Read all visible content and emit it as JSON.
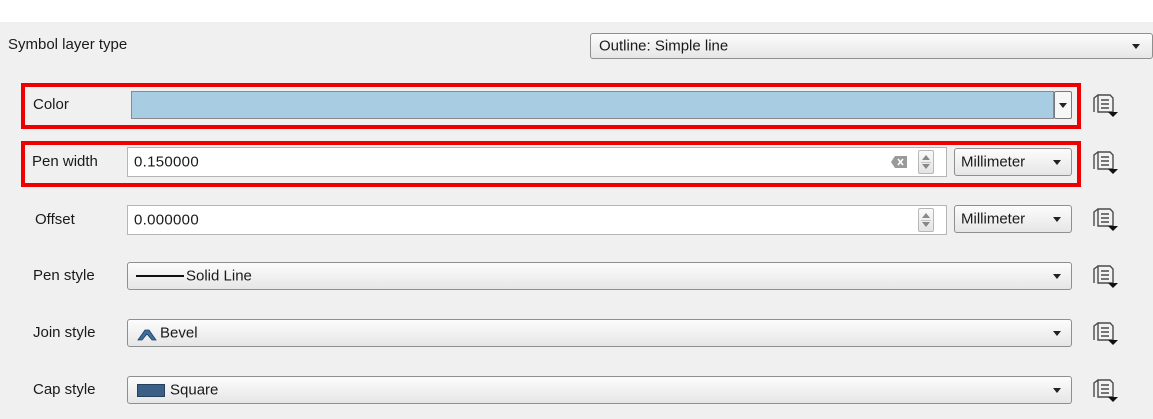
{
  "symbol_layer_type": {
    "label": "Symbol layer type",
    "value": "Outline: Simple line"
  },
  "color": {
    "label": "Color",
    "swatch": "#a8cde2"
  },
  "pen_width": {
    "label": "Pen width",
    "value": "0.150000",
    "unit": "Millimeter"
  },
  "offset": {
    "label": "Offset",
    "value": "0.000000",
    "unit": "Millimeter"
  },
  "pen_style": {
    "label": "Pen style",
    "value": "Solid Line"
  },
  "join_style": {
    "label": "Join style",
    "value": "Bevel"
  },
  "cap_style": {
    "label": "Cap style",
    "value": "Square"
  },
  "icons": {
    "data_defined": "data-defined-override-icon",
    "clear": "clear-field-icon",
    "solid_line": "solid-line-icon",
    "bevel": "bevel-join-icon",
    "square": "square-cap-icon"
  },
  "highlight_color": "#ee0000"
}
